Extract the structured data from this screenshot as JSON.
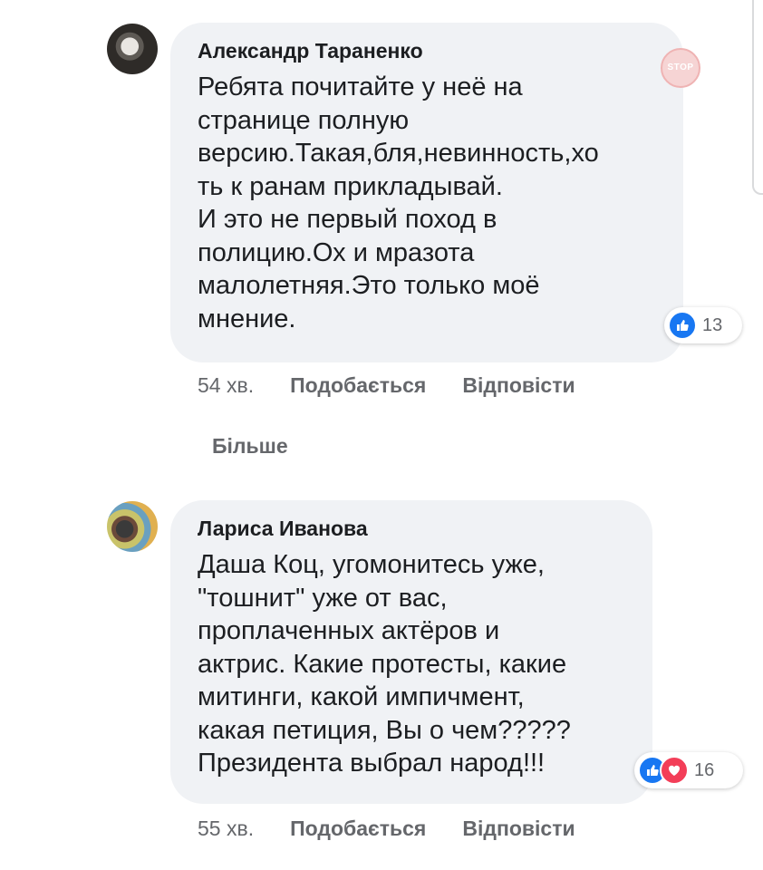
{
  "comments": [
    {
      "author": "Александр Тараненко",
      "text": "Ребята почитайте у неё на\nстранице полную\nверсию.Такая,бля,невинность,хо\nть к ранам прикладывай.\nИ это не первый поход в\nполицию.Ох и мразота\nмалолетняя.Это только моё\nмнение.",
      "reaction_count": "13",
      "time": "54 хв.",
      "like_label": "Подобається",
      "reply_label": "Відповісти"
    },
    {
      "author": "Лариса Иванова",
      "text": "Даша Коц, угомонитесь уже,\n\"тошнит\" уже от вас,\nпроплаченных актёров и\nактрис. Какие протесты, какие\nмитинги, какой импичмент,\nкакая петиция, Вы о чем?????\nПрезидента выбрал народ!!!",
      "reaction_count": "16",
      "time": "55 хв.",
      "like_label": "Подобається",
      "reply_label": "Відповісти"
    }
  ],
  "more_label": "Більше",
  "watermark": "STOP",
  "colors": {
    "bubble": "#f0f2f5",
    "like": "#1877f2",
    "love": "#f33e58",
    "meta_text": "#65676b"
  }
}
